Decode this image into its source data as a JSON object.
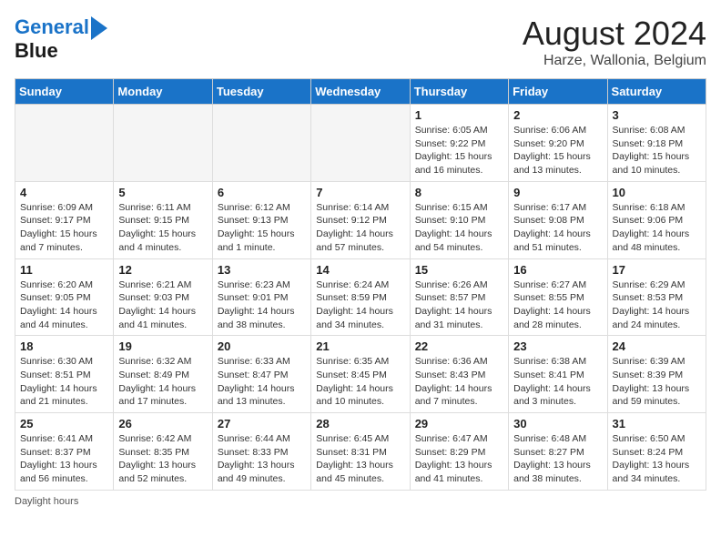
{
  "header": {
    "logo_line1": "General",
    "logo_line2": "Blue",
    "main_title": "August 2024",
    "subtitle": "Harze, Wallonia, Belgium"
  },
  "days_of_week": [
    "Sunday",
    "Monday",
    "Tuesday",
    "Wednesday",
    "Thursday",
    "Friday",
    "Saturday"
  ],
  "weeks": [
    [
      {
        "day": "",
        "info": ""
      },
      {
        "day": "",
        "info": ""
      },
      {
        "day": "",
        "info": ""
      },
      {
        "day": "",
        "info": ""
      },
      {
        "day": "1",
        "info": "Sunrise: 6:05 AM\nSunset: 9:22 PM\nDaylight: 15 hours and 16 minutes."
      },
      {
        "day": "2",
        "info": "Sunrise: 6:06 AM\nSunset: 9:20 PM\nDaylight: 15 hours and 13 minutes."
      },
      {
        "day": "3",
        "info": "Sunrise: 6:08 AM\nSunset: 9:18 PM\nDaylight: 15 hours and 10 minutes."
      }
    ],
    [
      {
        "day": "4",
        "info": "Sunrise: 6:09 AM\nSunset: 9:17 PM\nDaylight: 15 hours and 7 minutes."
      },
      {
        "day": "5",
        "info": "Sunrise: 6:11 AM\nSunset: 9:15 PM\nDaylight: 15 hours and 4 minutes."
      },
      {
        "day": "6",
        "info": "Sunrise: 6:12 AM\nSunset: 9:13 PM\nDaylight: 15 hours and 1 minute."
      },
      {
        "day": "7",
        "info": "Sunrise: 6:14 AM\nSunset: 9:12 PM\nDaylight: 14 hours and 57 minutes."
      },
      {
        "day": "8",
        "info": "Sunrise: 6:15 AM\nSunset: 9:10 PM\nDaylight: 14 hours and 54 minutes."
      },
      {
        "day": "9",
        "info": "Sunrise: 6:17 AM\nSunset: 9:08 PM\nDaylight: 14 hours and 51 minutes."
      },
      {
        "day": "10",
        "info": "Sunrise: 6:18 AM\nSunset: 9:06 PM\nDaylight: 14 hours and 48 minutes."
      }
    ],
    [
      {
        "day": "11",
        "info": "Sunrise: 6:20 AM\nSunset: 9:05 PM\nDaylight: 14 hours and 44 minutes."
      },
      {
        "day": "12",
        "info": "Sunrise: 6:21 AM\nSunset: 9:03 PM\nDaylight: 14 hours and 41 minutes."
      },
      {
        "day": "13",
        "info": "Sunrise: 6:23 AM\nSunset: 9:01 PM\nDaylight: 14 hours and 38 minutes."
      },
      {
        "day": "14",
        "info": "Sunrise: 6:24 AM\nSunset: 8:59 PM\nDaylight: 14 hours and 34 minutes."
      },
      {
        "day": "15",
        "info": "Sunrise: 6:26 AM\nSunset: 8:57 PM\nDaylight: 14 hours and 31 minutes."
      },
      {
        "day": "16",
        "info": "Sunrise: 6:27 AM\nSunset: 8:55 PM\nDaylight: 14 hours and 28 minutes."
      },
      {
        "day": "17",
        "info": "Sunrise: 6:29 AM\nSunset: 8:53 PM\nDaylight: 14 hours and 24 minutes."
      }
    ],
    [
      {
        "day": "18",
        "info": "Sunrise: 6:30 AM\nSunset: 8:51 PM\nDaylight: 14 hours and 21 minutes."
      },
      {
        "day": "19",
        "info": "Sunrise: 6:32 AM\nSunset: 8:49 PM\nDaylight: 14 hours and 17 minutes."
      },
      {
        "day": "20",
        "info": "Sunrise: 6:33 AM\nSunset: 8:47 PM\nDaylight: 14 hours and 13 minutes."
      },
      {
        "day": "21",
        "info": "Sunrise: 6:35 AM\nSunset: 8:45 PM\nDaylight: 14 hours and 10 minutes."
      },
      {
        "day": "22",
        "info": "Sunrise: 6:36 AM\nSunset: 8:43 PM\nDaylight: 14 hours and 7 minutes."
      },
      {
        "day": "23",
        "info": "Sunrise: 6:38 AM\nSunset: 8:41 PM\nDaylight: 14 hours and 3 minutes."
      },
      {
        "day": "24",
        "info": "Sunrise: 6:39 AM\nSunset: 8:39 PM\nDaylight: 13 hours and 59 minutes."
      }
    ],
    [
      {
        "day": "25",
        "info": "Sunrise: 6:41 AM\nSunset: 8:37 PM\nDaylight: 13 hours and 56 minutes."
      },
      {
        "day": "26",
        "info": "Sunrise: 6:42 AM\nSunset: 8:35 PM\nDaylight: 13 hours and 52 minutes."
      },
      {
        "day": "27",
        "info": "Sunrise: 6:44 AM\nSunset: 8:33 PM\nDaylight: 13 hours and 49 minutes."
      },
      {
        "day": "28",
        "info": "Sunrise: 6:45 AM\nSunset: 8:31 PM\nDaylight: 13 hours and 45 minutes."
      },
      {
        "day": "29",
        "info": "Sunrise: 6:47 AM\nSunset: 8:29 PM\nDaylight: 13 hours and 41 minutes."
      },
      {
        "day": "30",
        "info": "Sunrise: 6:48 AM\nSunset: 8:27 PM\nDaylight: 13 hours and 38 minutes."
      },
      {
        "day": "31",
        "info": "Sunrise: 6:50 AM\nSunset: 8:24 PM\nDaylight: 13 hours and 34 minutes."
      }
    ]
  ],
  "footer_label": "Daylight hours"
}
